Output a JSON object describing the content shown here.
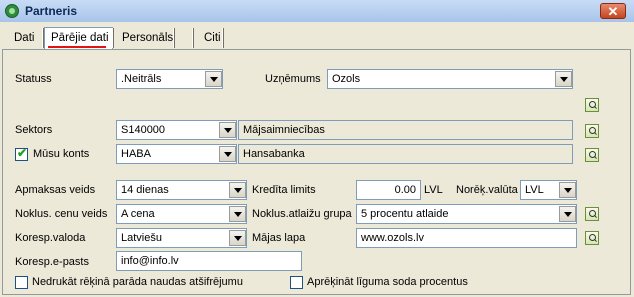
{
  "window": {
    "title": "Partneris",
    "close_glyph": "✕"
  },
  "tabs": [
    {
      "label": "Dati"
    },
    {
      "label": "Pārējie dati"
    },
    {
      "label": "Personāls"
    },
    {
      "label": ""
    },
    {
      "label": "Citi"
    },
    {
      "label": ""
    }
  ],
  "form": {
    "statuss": {
      "label": "Statuss",
      "value": ".Neitrāls"
    },
    "uznemums": {
      "label": "Uzņēmums",
      "value": "Ozols"
    },
    "sektors": {
      "label": "Sektors",
      "code": "S140000",
      "name": "Mājsaimniecības"
    },
    "musu_konts": {
      "label": "Mūsu konts",
      "checked": true,
      "code": "HABA",
      "name": "Hansabanka"
    },
    "apmaksas_veids": {
      "label": "Apmaksas veids",
      "value": "14 dienas"
    },
    "kredita_limits": {
      "label": "Kredīta limits",
      "value": "0.00",
      "unit": "LVL"
    },
    "norek_valuta": {
      "label": "Norēķ.valūta",
      "value": "LVL"
    },
    "noklus_cenu_veids": {
      "label": "Noklus. cenu veids",
      "value": "A cena"
    },
    "noklus_atlaizu_grupa": {
      "label": "Noklus.atlaižu grupa",
      "value": "5 procentu atlaide"
    },
    "koresp_valoda": {
      "label": "Koresp.valoda",
      "value": "Latviešu"
    },
    "majas_lapa": {
      "label": "Mājas lapa",
      "value": "www.ozols.lv"
    },
    "koresp_epasts": {
      "label": "Koresp.e-pasts",
      "value": "info@info.lv"
    },
    "nedrukat": {
      "label": "Nedrukāt rēķinā parāda naudas atšifrējumu",
      "checked": false
    },
    "aprekinat": {
      "label": "Aprēķināt līguma soda procentus",
      "checked": false
    }
  },
  "check_glyph": "✔"
}
